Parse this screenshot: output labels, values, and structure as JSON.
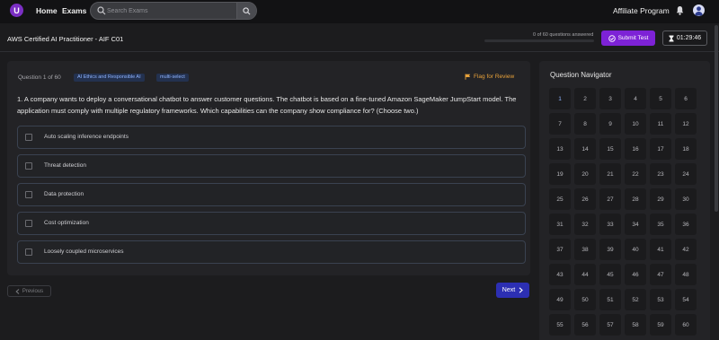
{
  "topnav": {
    "logo_letter": "U",
    "home_label": "Home",
    "exams_label": "Exams",
    "search_placeholder": "Search Exams",
    "affiliate_label": "Affiliate Program"
  },
  "header": {
    "exam_title": "AWS Certified AI Practitioner - AIF C01",
    "progress_text": "0 of 60 questions answered",
    "progress_fraction": 0,
    "submit_label": "Submit Test",
    "timer": "01:29:46"
  },
  "question": {
    "number_label": "Question 1 of 60",
    "tags": [
      "AI Ethics and Responsible AI",
      "multi-select"
    ],
    "flag_label": "Flag for Review",
    "text": "1. A company wants to deploy a conversational chatbot to answer customer questions. The chatbot is based on a fine-tuned Amazon SageMaker JumpStart model. The application must comply with multiple regulatory frameworks. Which capabilities can the company show compliance for? (Choose two.)",
    "options": [
      "Auto scaling inference endpoints",
      "Threat detection",
      "Data protection",
      "Cost optimization",
      "Loosely coupled microservices"
    ]
  },
  "footer": {
    "previous_label": "Previous",
    "next_label": "Next"
  },
  "navigator": {
    "title": "Question Navigator",
    "current": 1,
    "questions": [
      1,
      2,
      3,
      4,
      5,
      6,
      7,
      8,
      9,
      10,
      11,
      12,
      13,
      14,
      15,
      16,
      17,
      18,
      19,
      20,
      21,
      22,
      23,
      24,
      25,
      26,
      27,
      28,
      29,
      30,
      31,
      32,
      33,
      34,
      35,
      36,
      37,
      38,
      39,
      40,
      41,
      42,
      43,
      44,
      45,
      46,
      47,
      48,
      49,
      50,
      51,
      52,
      53,
      54,
      55,
      56,
      57,
      58,
      59,
      60
    ]
  },
  "colors": {
    "accent_purple": "#7d22d6",
    "next_blue": "#2c2fb3",
    "flag_orange": "#e8a23a",
    "tag_blue": "#8fb4ff"
  }
}
